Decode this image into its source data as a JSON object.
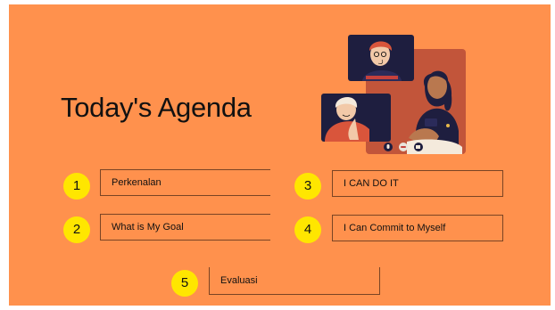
{
  "slide": {
    "title": "Today's Agenda",
    "accent_color": "#FF914D",
    "badge_color": "#FFE600"
  },
  "agenda": [
    {
      "number": "1",
      "label": "Perkenalan"
    },
    {
      "number": "2",
      "label": "What is My Goal"
    },
    {
      "number": "3",
      "label": "I CAN DO IT"
    },
    {
      "number": "4",
      "label": "I Can Commit to Myself"
    },
    {
      "number": "5",
      "label": "Evaluasi"
    }
  ],
  "illustration": {
    "icons": [
      "video-call-illustration",
      "microphone-icon",
      "end-call-icon",
      "camera-icon"
    ]
  }
}
